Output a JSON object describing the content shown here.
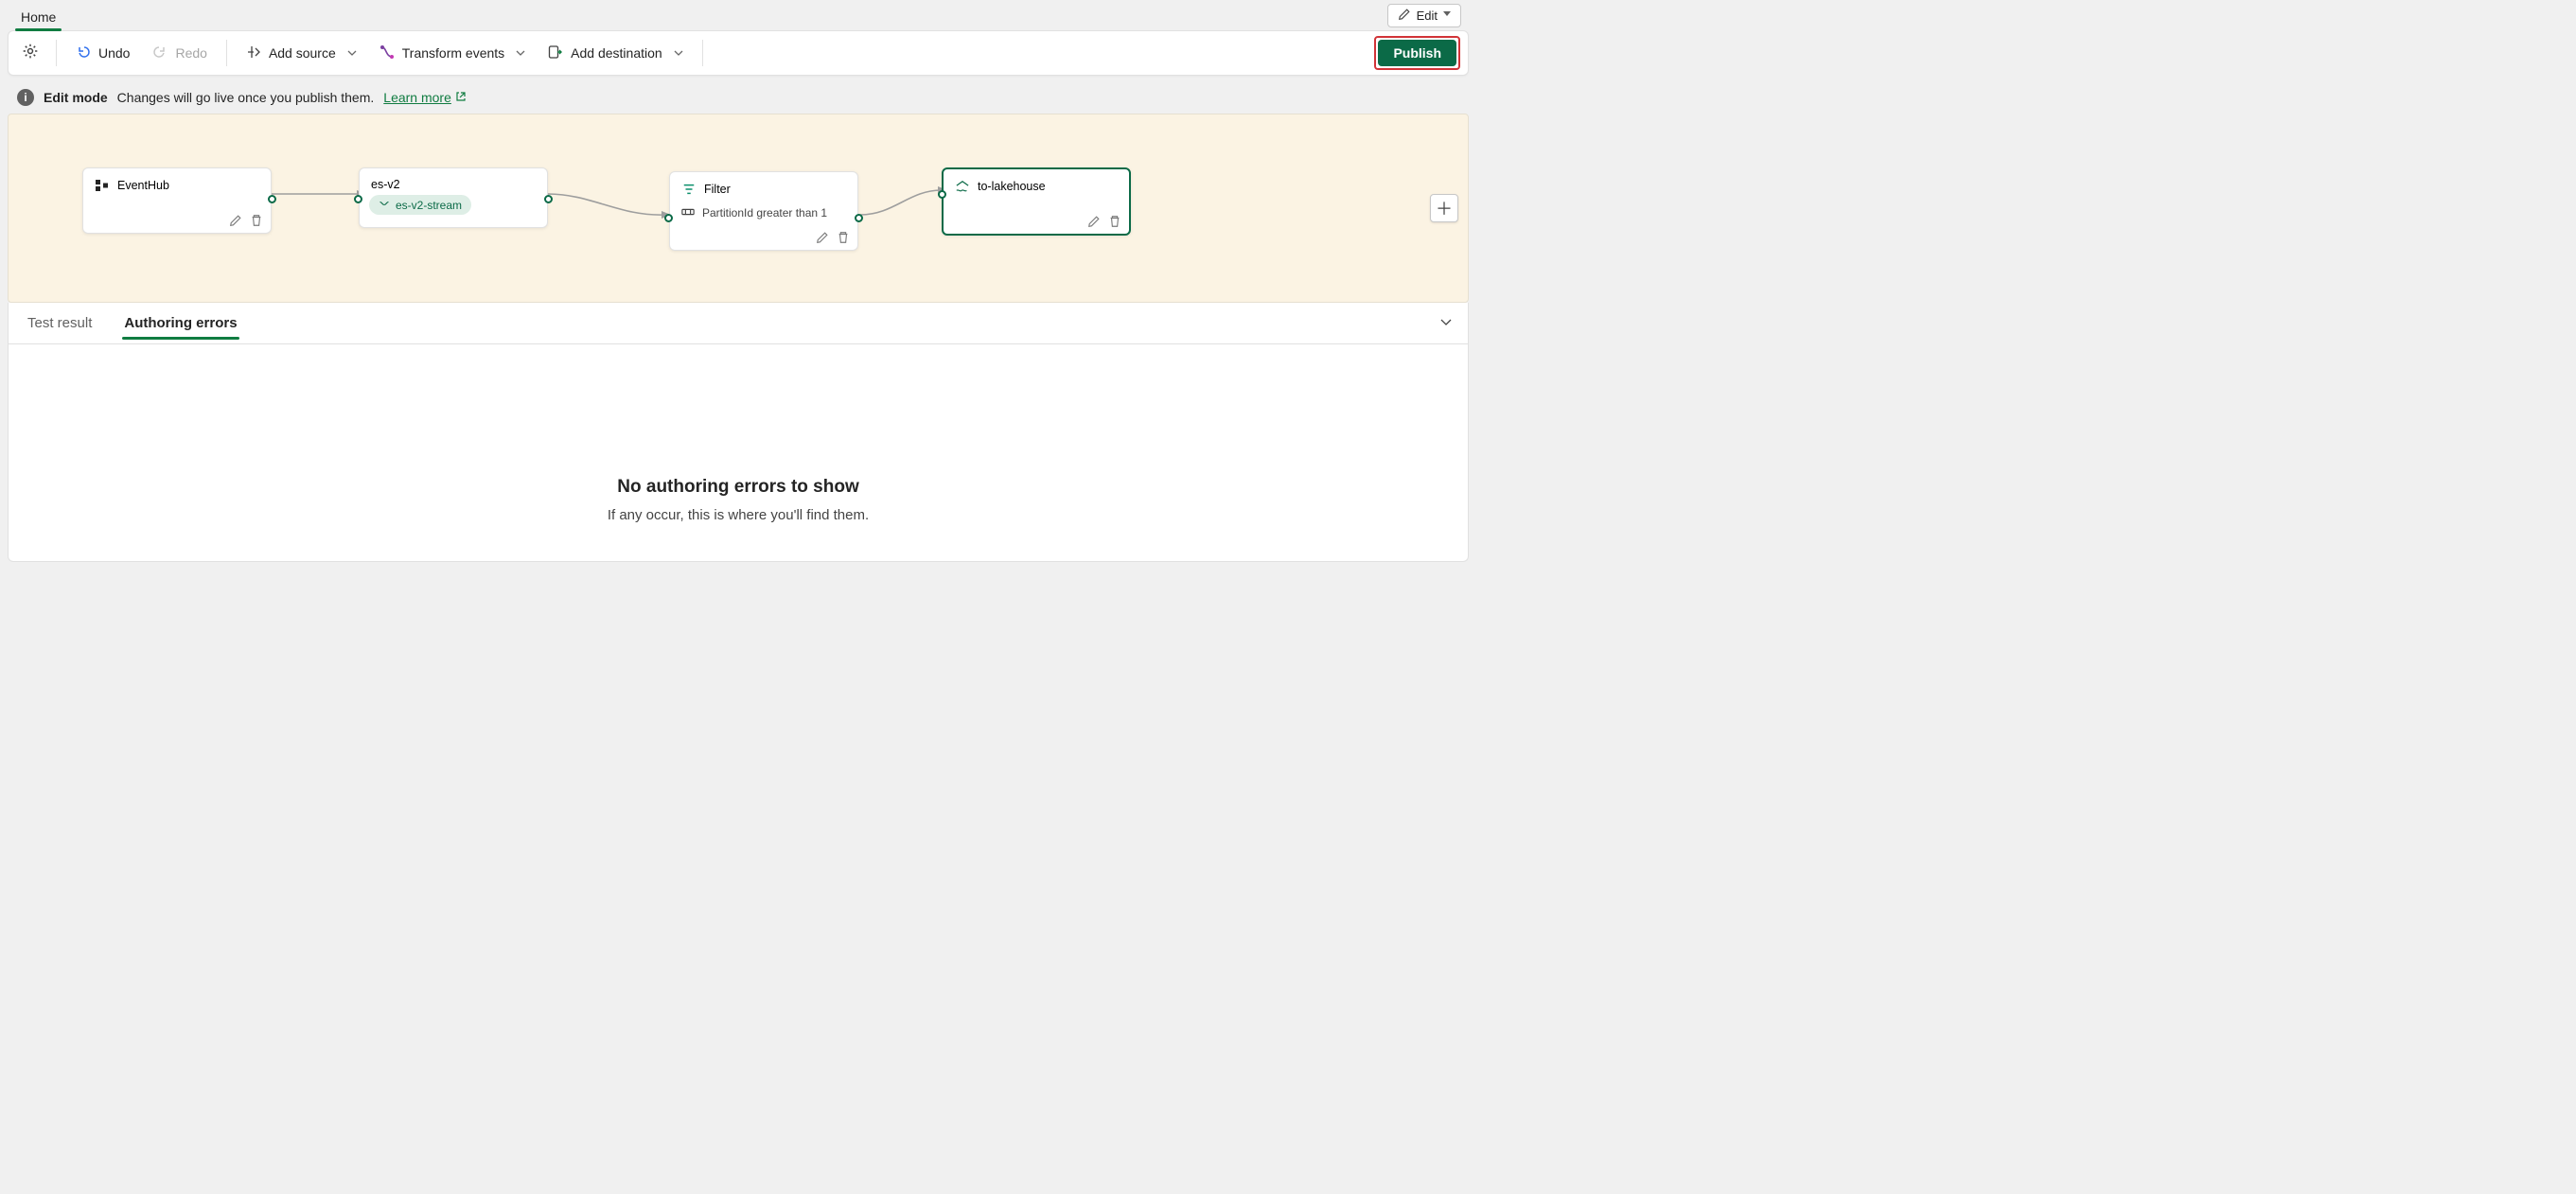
{
  "ribbon": {
    "tabs": [
      {
        "label": "Home",
        "active": true
      }
    ],
    "edit_label": "Edit"
  },
  "toolbar": {
    "undo_label": "Undo",
    "redo_label": "Redo",
    "add_source_label": "Add source",
    "transform_label": "Transform events",
    "add_destination_label": "Add destination",
    "publish_label": "Publish"
  },
  "info_bar": {
    "title": "Edit mode",
    "message": "Changes will go live once you publish them.",
    "link_label": "Learn more"
  },
  "canvas": {
    "nodes": {
      "source": {
        "title": "EventHub"
      },
      "stream": {
        "title": "es-v2",
        "chip": "es-v2-stream"
      },
      "filter": {
        "title": "Filter",
        "condition": "PartitionId greater than 1"
      },
      "destination": {
        "title": "to-lakehouse"
      }
    }
  },
  "bottom": {
    "tabs": {
      "test_result": "Test result",
      "authoring_errors": "Authoring errors"
    },
    "empty": {
      "heading": "No authoring errors to show",
      "sub": "If any occur, this is where you'll find them."
    }
  }
}
